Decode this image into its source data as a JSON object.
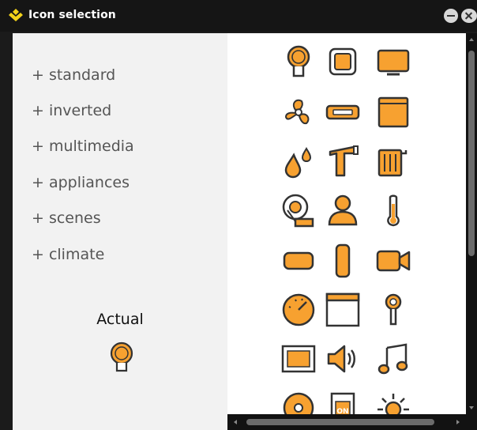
{
  "window": {
    "title": "Icon selection",
    "accent_color": "#f7a130",
    "outline_color": "#333333"
  },
  "categories": [
    {
      "label": "+ standard"
    },
    {
      "label": "+ inverted"
    },
    {
      "label": "+ multimedia"
    },
    {
      "label": "+ appliances"
    },
    {
      "label": "+ scenes"
    },
    {
      "label": "+ climate"
    }
  ],
  "actual": {
    "label": "Actual",
    "icon": "lamp-bulb-icon"
  },
  "icon_grid": [
    [
      "lamp-bulb-icon",
      "square-button-icon",
      "monitor-icon"
    ],
    [
      "fan-icon",
      "wall-socket-icon",
      "panel-icon"
    ],
    [
      "water-drops-icon",
      "tap-icon",
      "radiator-icon"
    ],
    [
      "tape-measure-icon",
      "person-icon",
      "thermometer-icon"
    ],
    [
      "horizontal-switch-icon",
      "vertical-switch-icon",
      "camera-icon"
    ],
    [
      "dimmer-knob-icon",
      "window-icon",
      "pin-icon"
    ],
    [
      "screen-icon",
      "speaker-icon",
      "music-note-icon"
    ],
    [
      "disc-icon",
      "on-switch-icon",
      "sun-icon"
    ]
  ],
  "on_switch_text": "ON"
}
